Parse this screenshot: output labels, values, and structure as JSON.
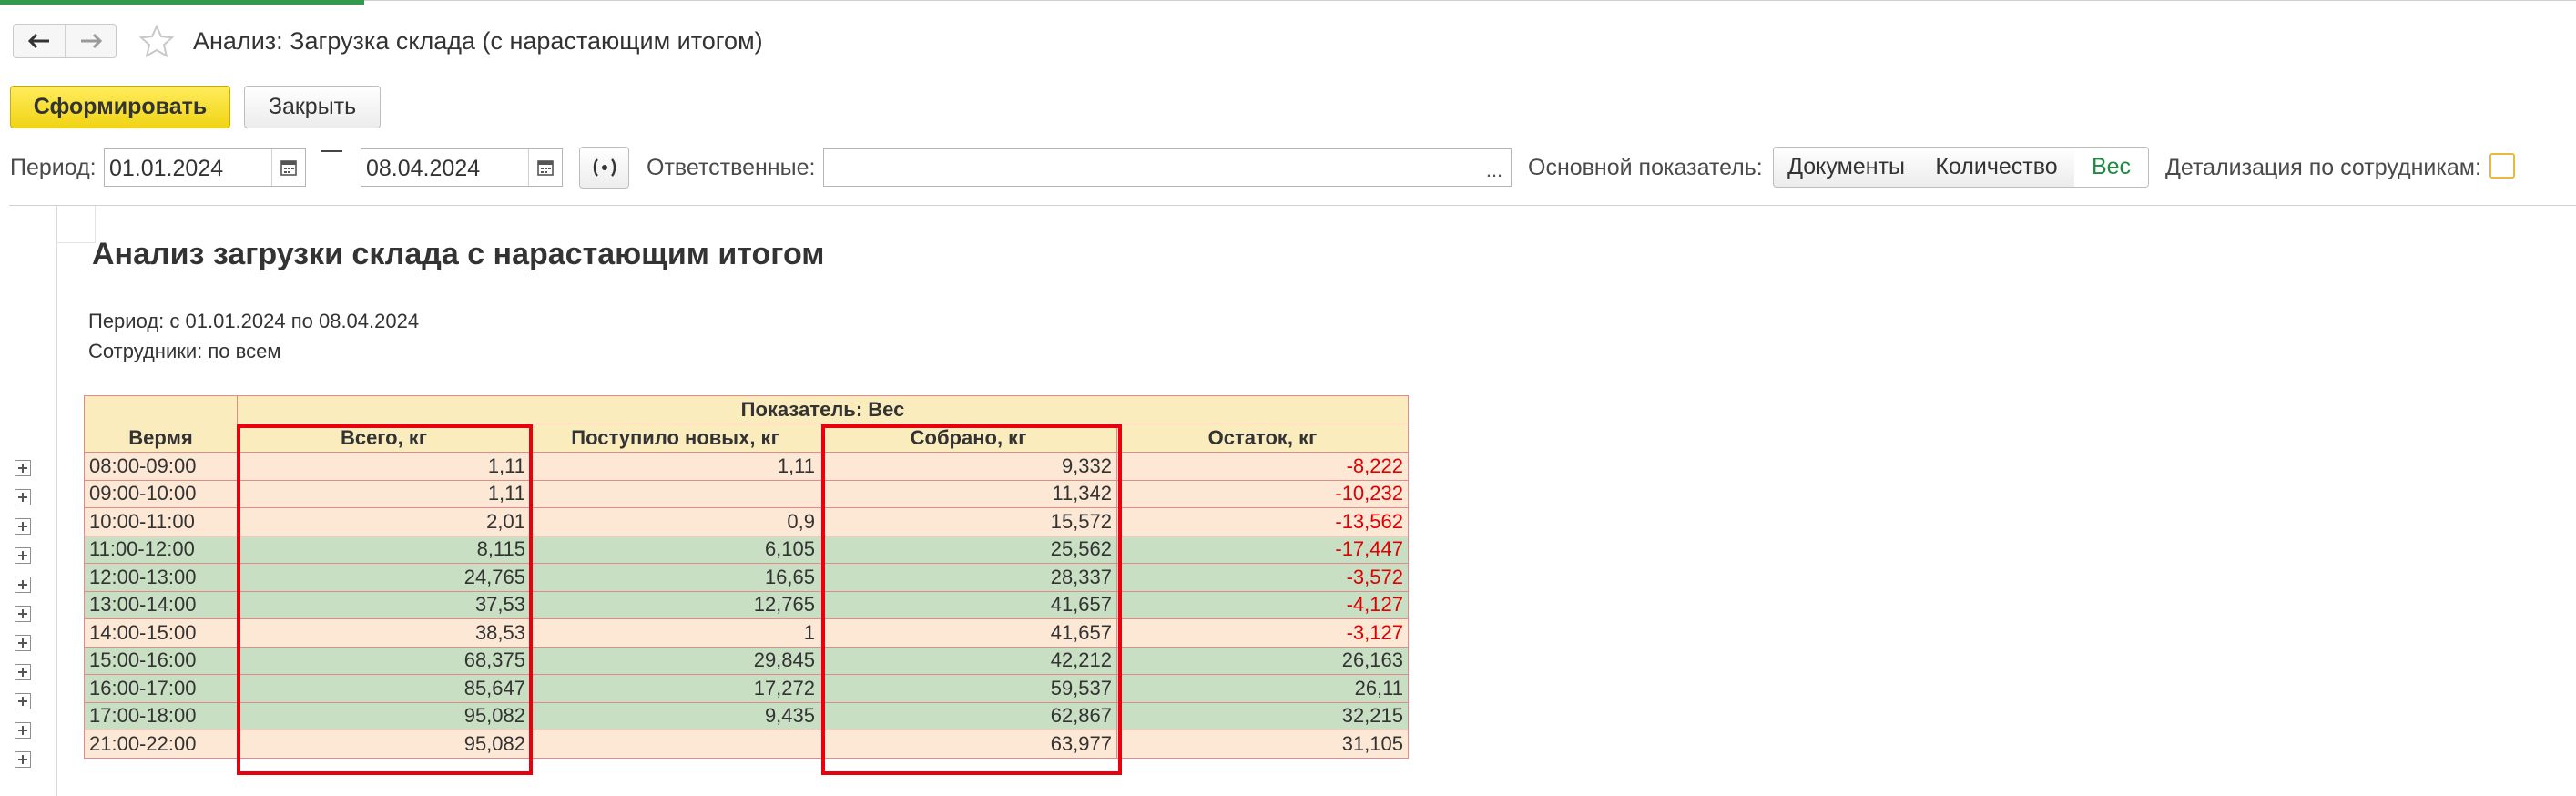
{
  "window": {
    "title": "Анализ: Загрузка склада (с нарастающим итогом)"
  },
  "commands": {
    "generate_label": "Сформировать",
    "close_label": "Закрыть"
  },
  "params": {
    "period_label": "Период:",
    "date_from": "01.01.2024",
    "date_to": "08.04.2024",
    "responsible_label": "Ответственные:",
    "responsible_value": "",
    "dots_label": "...",
    "indicator_label": "Основной показатель:",
    "indicator_options": [
      "Документы",
      "Количество",
      "Вес"
    ],
    "indicator_selected": "Вес",
    "detail_label": "Детализация по сотрудникам:",
    "detail_checked": false
  },
  "report": {
    "title": "Анализ загрузки склада с нарастающим итогом",
    "period_line": "Период: с 01.01.2024 по 08.04.2024",
    "employees_line": "Сотрудники: по всем",
    "header_group": "Показатель: Вес",
    "col_time": "Вермя",
    "columns": [
      "Всего, кг",
      "Поступило новых, кг",
      "Собрано, кг",
      "Остаток, кг"
    ],
    "rows": [
      {
        "time": "08:00-09:00",
        "total": "1,11",
        "new": "1,11",
        "collected": "9,332",
        "rest": "-8,222",
        "style": "peach",
        "neg": true
      },
      {
        "time": "09:00-10:00",
        "total": "1,11",
        "new": "",
        "collected": "11,342",
        "rest": "-10,232",
        "style": "peach",
        "neg": true
      },
      {
        "time": "10:00-11:00",
        "total": "2,01",
        "new": "0,9",
        "collected": "15,572",
        "rest": "-13,562",
        "style": "peach",
        "neg": true
      },
      {
        "time": "11:00-12:00",
        "total": "8,115",
        "new": "6,105",
        "collected": "25,562",
        "rest": "-17,447",
        "style": "green",
        "neg": true
      },
      {
        "time": "12:00-13:00",
        "total": "24,765",
        "new": "16,65",
        "collected": "28,337",
        "rest": "-3,572",
        "style": "green",
        "neg": true
      },
      {
        "time": "13:00-14:00",
        "total": "37,53",
        "new": "12,765",
        "collected": "41,657",
        "rest": "-4,127",
        "style": "green",
        "neg": true
      },
      {
        "time": "14:00-15:00",
        "total": "38,53",
        "new": "1",
        "collected": "41,657",
        "rest": "-3,127",
        "style": "peach",
        "neg": true
      },
      {
        "time": "15:00-16:00",
        "total": "68,375",
        "new": "29,845",
        "collected": "42,212",
        "rest": "26,163",
        "style": "green",
        "neg": false
      },
      {
        "time": "16:00-17:00",
        "total": "85,647",
        "new": "17,272",
        "collected": "59,537",
        "rest": "26,11",
        "style": "green",
        "neg": false
      },
      {
        "time": "17:00-18:00",
        "total": "95,082",
        "new": "9,435",
        "collected": "62,867",
        "rest": "32,215",
        "style": "green",
        "neg": false
      },
      {
        "time": "21:00-22:00",
        "total": "95,082",
        "new": "",
        "collected": "63,977",
        "rest": "31,105",
        "style": "peach",
        "neg": false
      }
    ]
  },
  "colors": {
    "accent_green": "#2e9c4a",
    "primary_button": "#f7dd2c",
    "highlight_frame": "#e8000d",
    "negative_value": "#e00000"
  }
}
